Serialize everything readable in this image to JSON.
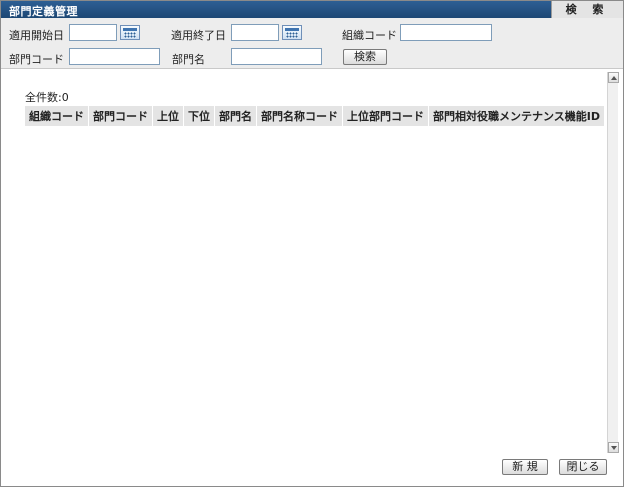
{
  "window": {
    "title": "部門定義管理",
    "mode_tab": "検 索"
  },
  "search": {
    "start_date_label": "適用開始日",
    "start_date_value": "",
    "end_date_label": "適用終了日",
    "end_date_value": "",
    "org_code_label": "組織コード",
    "org_code_value": "",
    "dept_code_label": "部門コード",
    "dept_code_value": "",
    "dept_name_label": "部門名",
    "dept_name_value": "",
    "search_button": "検索"
  },
  "results": {
    "count_label": "全件数:0",
    "columns": [
      "組織コード",
      "部門コード",
      "上位",
      "下位",
      "部門名",
      "部門名称コード",
      "上位部門コード",
      "部門相対役職メンテナンス機能ID"
    ]
  },
  "footer": {
    "new_button": "新 規",
    "close_button": "閉じる"
  }
}
